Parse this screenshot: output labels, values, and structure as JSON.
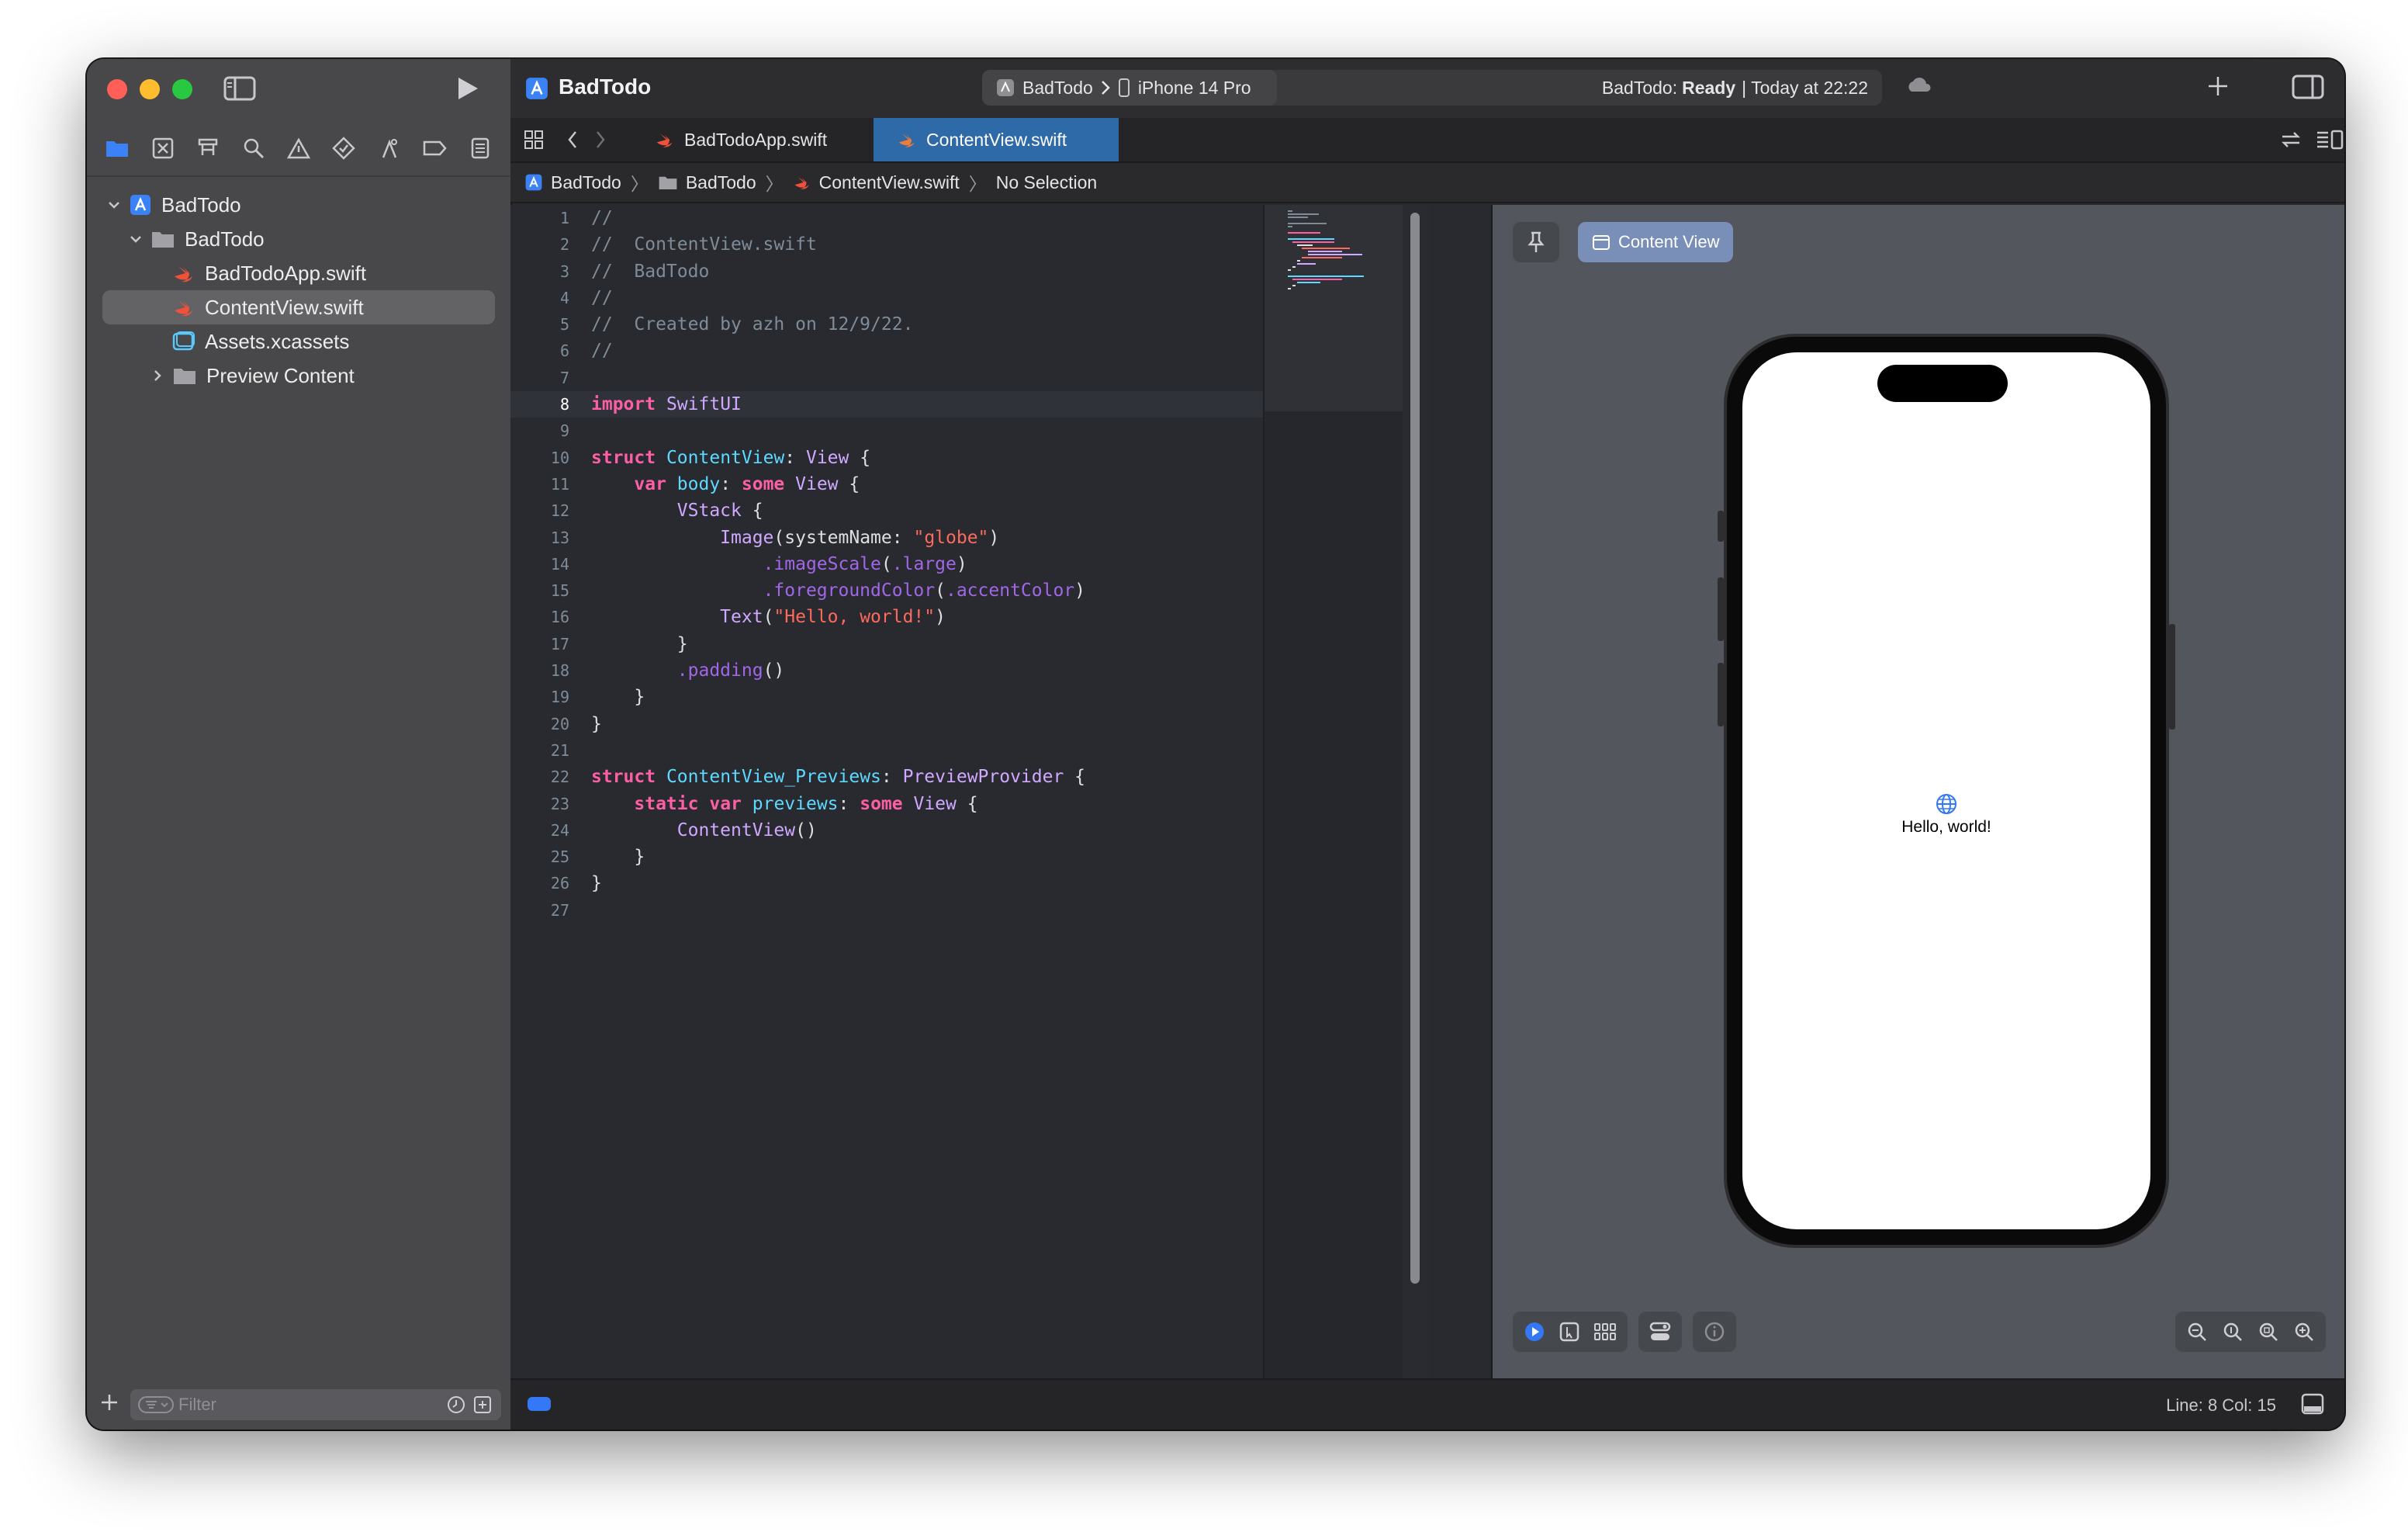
{
  "window": {
    "project": "BadTodo",
    "scheme": "BadTodo",
    "device": "iPhone 14 Pro",
    "status_prefix": "BadTodo:",
    "status_state": "Ready",
    "status_time": "| Today at 22:22"
  },
  "tabs": [
    {
      "label": "BadTodoApp.swift"
    },
    {
      "label": "ContentView.swift",
      "active": true
    }
  ],
  "breadcrumb": [
    "BadTodo",
    "BadTodo",
    "ContentView.swift",
    "No Selection"
  ],
  "navigator": {
    "items": [
      {
        "label": "BadTodo",
        "type": "project"
      },
      {
        "label": "BadTodo",
        "type": "folder"
      },
      {
        "label": "BadTodoApp.swift",
        "type": "swift"
      },
      {
        "label": "ContentView.swift",
        "type": "swift",
        "selected": true
      },
      {
        "label": "Assets.xcassets",
        "type": "assets"
      },
      {
        "label": "Preview Content",
        "type": "folder"
      }
    ],
    "filter_placeholder": "Filter"
  },
  "editor": {
    "current_line": 8,
    "lines": [
      "//",
      "//  ContentView.swift",
      "//  BadTodo",
      "//",
      "//  Created by azh on 12/9/22.",
      "//",
      "",
      "import SwiftUI",
      "",
      "struct ContentView: View {",
      "    var body: some View {",
      "        VStack {",
      "            Image(systemName: \"globe\")",
      "                .imageScale(.large)",
      "                .foregroundColor(.accentColor)",
      "            Text(\"Hello, world!\")",
      "        }",
      "        .padding()",
      "    }",
      "}",
      "",
      "struct ContentView_Previews: PreviewProvider {",
      "    static var previews: some View {",
      "        ContentView()",
      "    }",
      "}",
      ""
    ]
  },
  "canvas": {
    "preview_button": "Content View",
    "preview_text": "Hello, world!"
  },
  "statusbar": {
    "position": "Line: 8  Col: 15"
  },
  "colors": {
    "accent": "#2f6aa8",
    "keyword": "#fc5fa3",
    "type": "#5dd8ff",
    "string": "#fc6a5d",
    "comment": "#7f8c98"
  }
}
